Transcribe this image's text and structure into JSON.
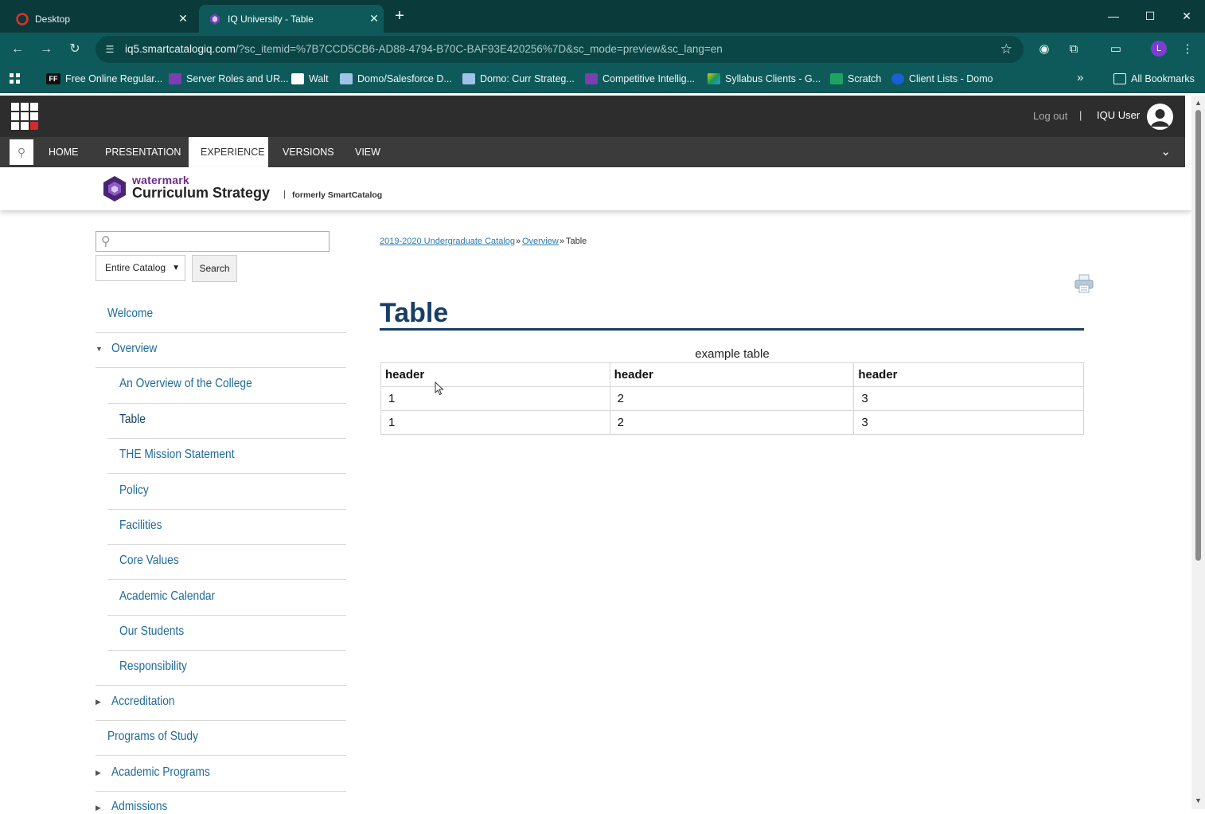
{
  "browser": {
    "tabs": [
      {
        "title": "Desktop",
        "active": false
      },
      {
        "title": "IQ University - Table",
        "active": true
      }
    ],
    "url_host": "iq5.smartcatalogiq.com",
    "url_path": "/?sc_itemid=%7B7CCD5CB6-AD88-4794-B70C-BAF93E420256%7D&sc_mode=preview&sc_lang=en",
    "profile_initial": "L",
    "bookmarks": [
      "Free Online Regular...",
      "Server Roles and UR...",
      "Walt",
      "Domo/Salesforce D...",
      "Domo: Curr Strateg...",
      "Competitive Intellig...",
      "Syllabus Clients - G...",
      "Scratch",
      "Client Lists - Domo"
    ],
    "bookmarks_overflow": "»",
    "all_bookmarks": "All Bookmarks"
  },
  "cms": {
    "logout": "Log out",
    "separator": "|",
    "user": "IQU User",
    "menu": [
      "HOME",
      "PRESENTATION",
      "EXPERIENCE",
      "VERSIONS",
      "VIEW"
    ],
    "active_menu": "EXPERIENCE"
  },
  "brand": {
    "watermark": "watermark",
    "product": "Curriculum Strategy",
    "pipe": "|",
    "formerly": "formerly SmartCatalog"
  },
  "search": {
    "scope": "Entire Catalog",
    "button": "Search"
  },
  "nav": {
    "items": [
      "Welcome",
      "Overview",
      "An Overview of the College",
      "Table",
      "THE Mission Statement",
      "Policy",
      "Facilities",
      "Core Values",
      "Academic Calendar",
      "Our Students",
      "Responsibility",
      "Accreditation",
      "Programs of Study",
      "Academic Programs",
      "Admissions"
    ],
    "current": "Table"
  },
  "breadcrumb": {
    "items": [
      "2019-2020 Undergraduate Catalog",
      "Overview"
    ],
    "separator": "»",
    "current": "Table"
  },
  "page": {
    "title": "Table",
    "table": {
      "caption": "example table",
      "headers": [
        "header",
        "header",
        "header"
      ],
      "rows": [
        [
          "1",
          "2",
          "3"
        ],
        [
          "1",
          "2",
          "3"
        ]
      ]
    }
  },
  "colors": {
    "chrome_dark": "#0b3a3a",
    "chrome": "#0e5a5a",
    "cms_bar": "#2d2d2d",
    "menu_bar": "#3b3b3b",
    "title_navy": "#173e66",
    "link_blue": "#1f6a9a"
  }
}
